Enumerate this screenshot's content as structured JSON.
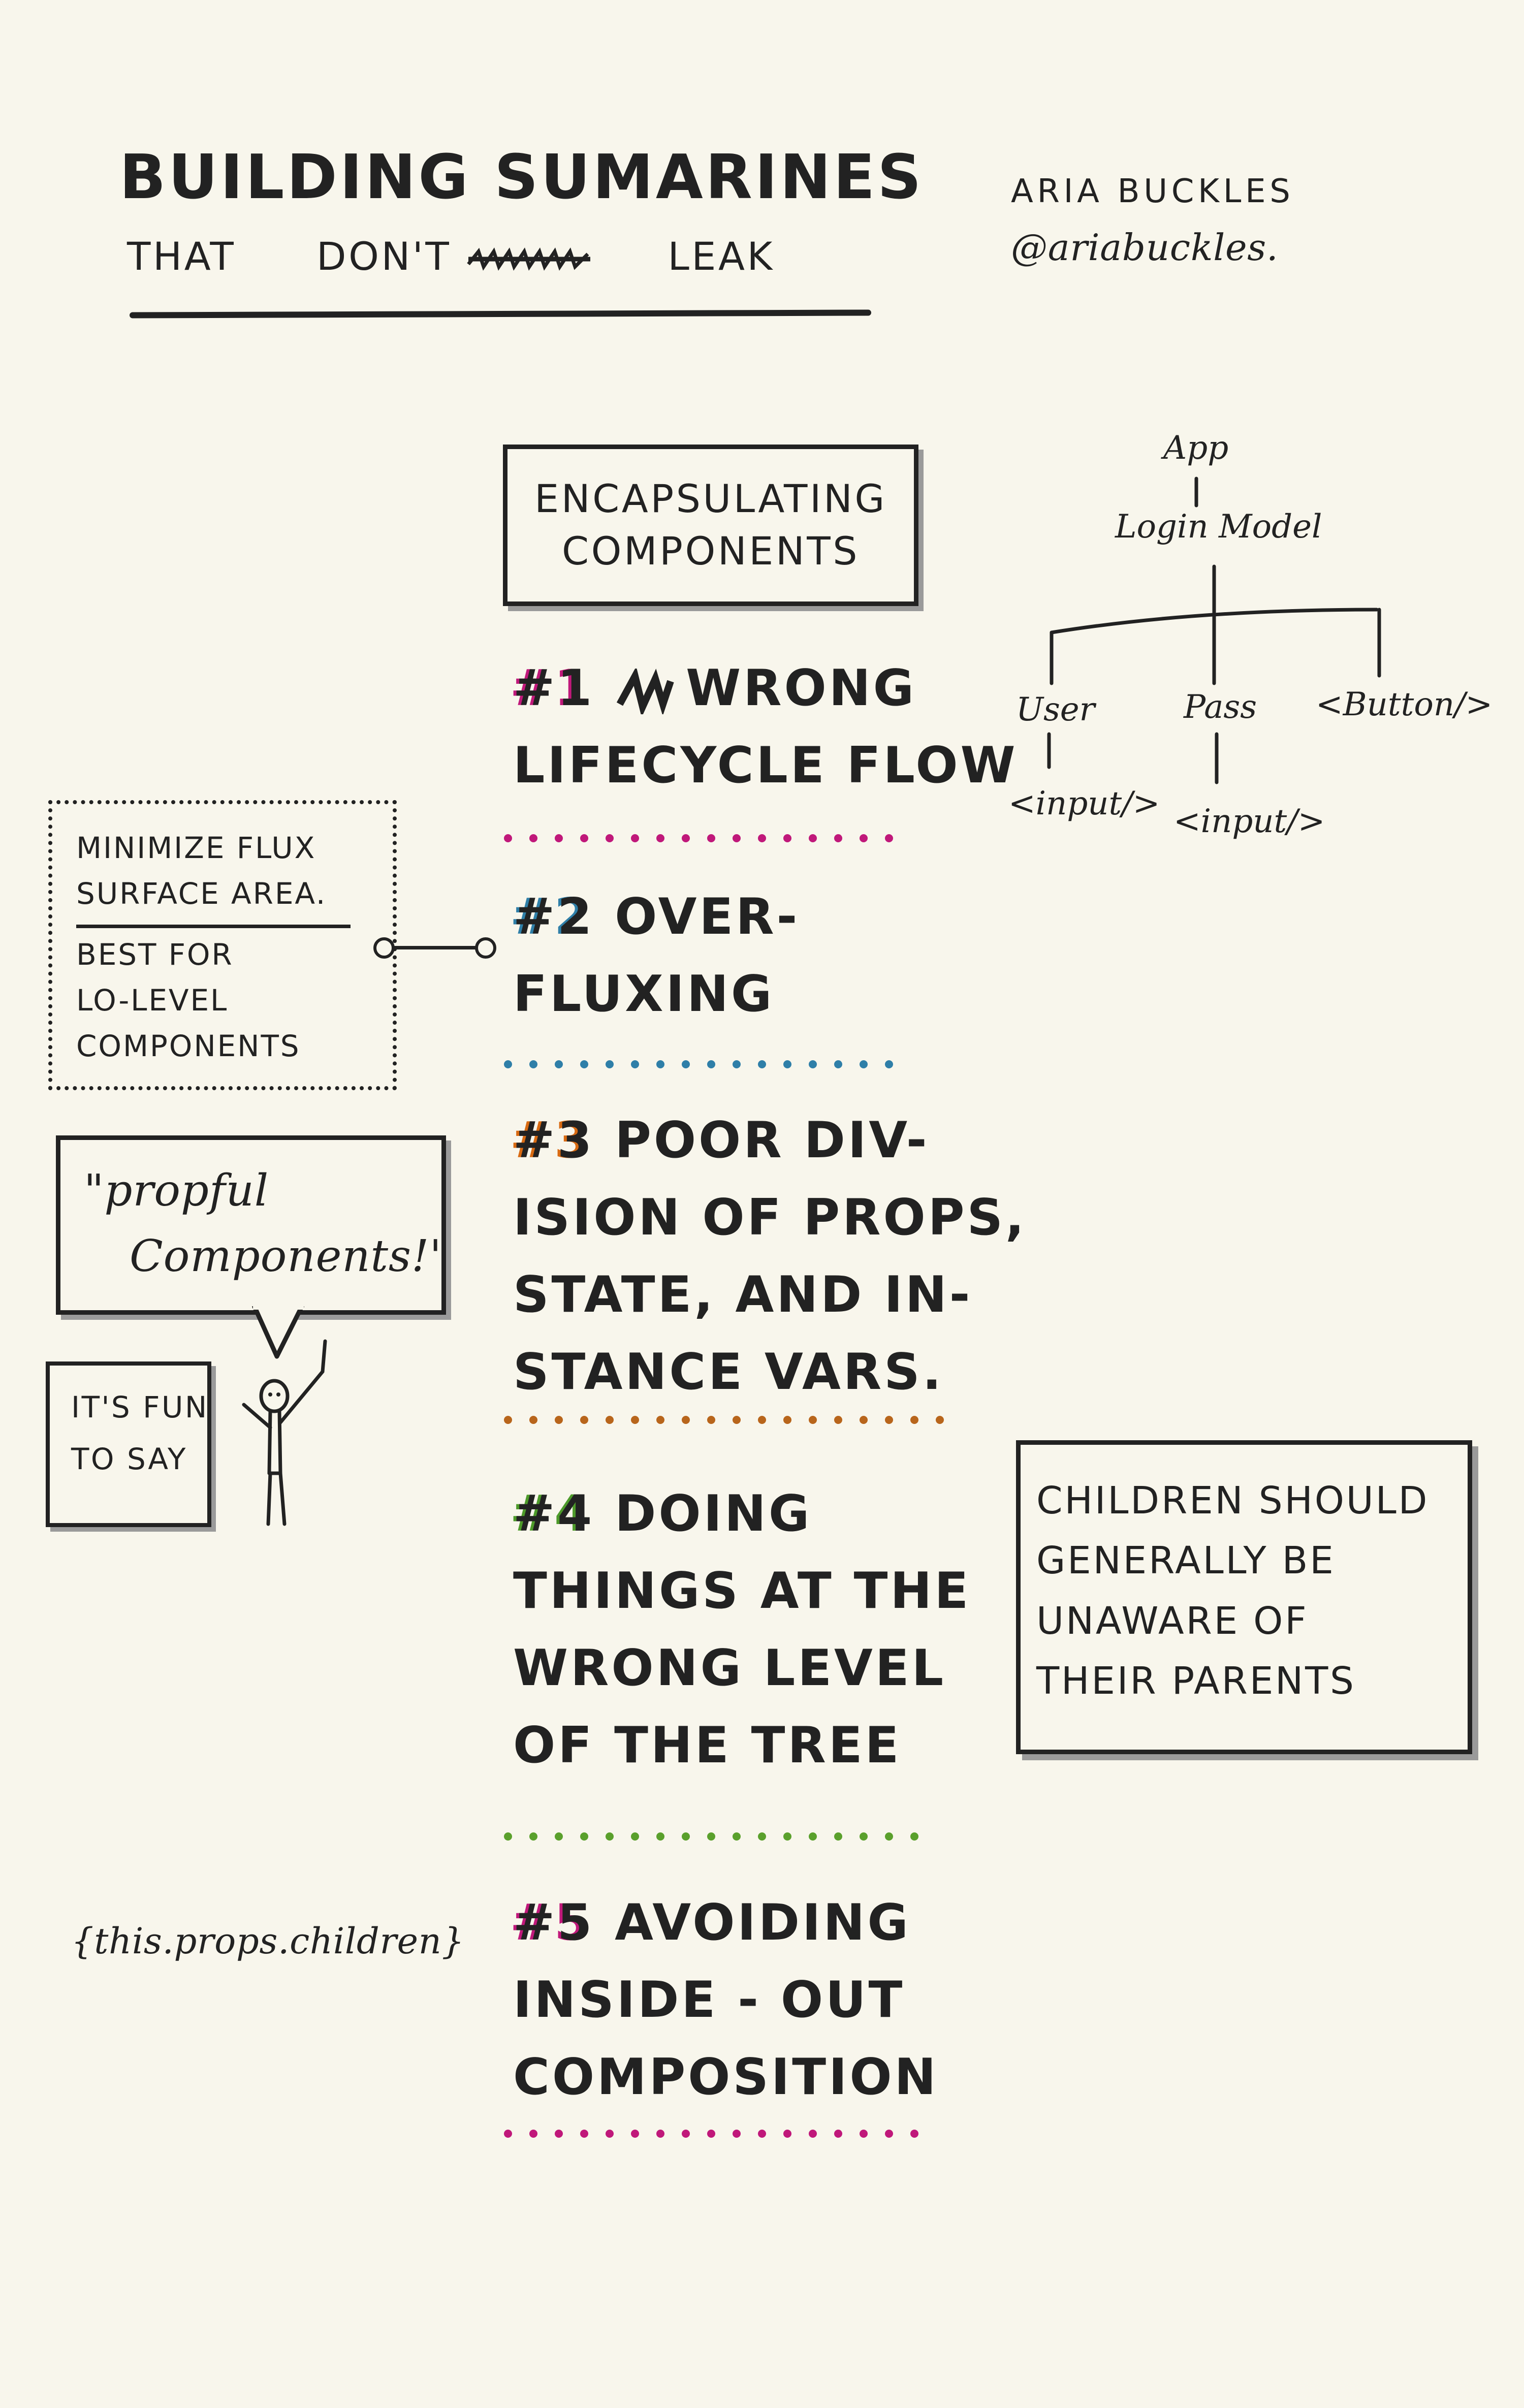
{
  "header": {
    "title_line1": "BUILDING SUMARINES",
    "title_line2_a": "THAT",
    "title_line2_b": "DON'T",
    "title_line2_c": "LEAK",
    "author_name": "ARIA BUCKLES",
    "author_handle": "@ariabuckles."
  },
  "section": {
    "line1": "ENCAPSULATING",
    "line2": "COMPONENTS"
  },
  "items": [
    {
      "num": "#1",
      "lines": [
        "WRONG",
        "LIFECYCLE FLOW"
      ]
    },
    {
      "num": "#2",
      "lines": [
        "OVER-",
        "FLUXING"
      ]
    },
    {
      "num": "#3",
      "lines": [
        "POOR DIV-",
        "ISION OF PROPS,",
        "STATE, AND IN-",
        "STANCE VARS."
      ]
    },
    {
      "num": "#4",
      "lines": [
        "DOING",
        "THINGS AT THE",
        "WRONG LEVEL",
        "OF THE TREE"
      ]
    },
    {
      "num": "#5",
      "lines": [
        "AVOIDING",
        "INSIDE - OUT",
        "COMPOSITION"
      ]
    }
  ],
  "tree": {
    "root": "App",
    "model": "Login Model",
    "user": "User",
    "pass": "Pass",
    "button": "<Button/>",
    "input1": "<input/>",
    "input2": "<input/>"
  },
  "flux_note": {
    "line1": "MINIMIZE FLUX",
    "line2": "SURFACE AREA.",
    "line3": "BEST FOR",
    "line4": "LO-LEVEL",
    "line5": "COMPONENTS"
  },
  "bubble": {
    "line1": "\"propful",
    "line2": "Components!\""
  },
  "fun_note": {
    "line1": "IT'S FUN",
    "line2": "TO SAY"
  },
  "children_note": {
    "line1": "CHILDREN SHOULD",
    "line2": "GENERALLY BE",
    "line3": "UNAWARE OF",
    "line4": "THEIR PARENTS"
  },
  "props_children": "{this.props.children}",
  "colors": {
    "ink": "#222222",
    "paper": "#f8f6ec",
    "dots": [
      "#c0187a",
      "#2f7fa8",
      "#b8651b",
      "#5aa02c",
      "#c0187a"
    ],
    "num_accents": [
      "#c0187a",
      "#2f7fa8",
      "#d86a12",
      "#4d9a2a",
      "#c0187a"
    ]
  }
}
